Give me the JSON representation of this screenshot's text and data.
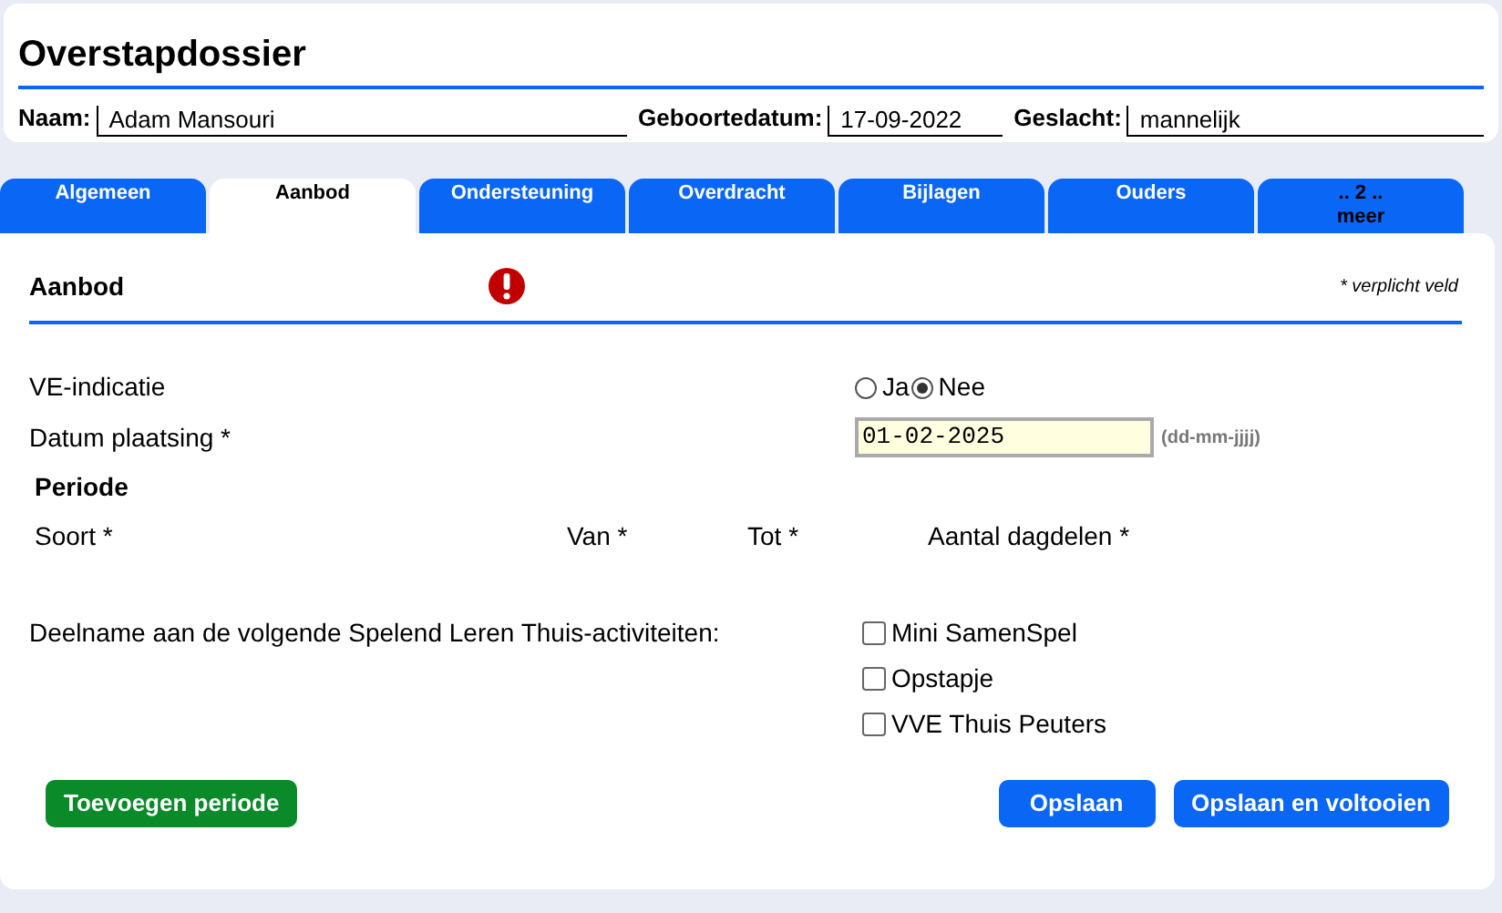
{
  "title": "Overstapdossier",
  "person": [
    {
      "label": "Naam:",
      "value": "Adam Mansouri"
    },
    {
      "label": "Geboortedatum:",
      "value": "17-09-2022"
    },
    {
      "label": "Geslacht:",
      "value": "mannelijk"
    }
  ],
  "tabs": [
    {
      "label": "Algemeen",
      "selected": false
    },
    {
      "label": "Aanbod",
      "selected": true
    },
    {
      "label": "Ondersteuning",
      "selected": false
    },
    {
      "label": "Overdracht",
      "selected": false
    },
    {
      "label": "Bijlagen",
      "selected": false
    },
    {
      "label": "Ouders",
      "selected": false
    },
    {
      "label": ".. 2 ..",
      "sublabel": "meer",
      "selected": false
    }
  ],
  "section": {
    "title": "Aanbod",
    "warning": true,
    "required_note": "* verplicht veld"
  },
  "ve_indicatie": {
    "label": "VE-indicatie",
    "options": [
      {
        "label": "Ja",
        "selected": false
      },
      {
        "label": "Nee",
        "selected": true
      }
    ]
  },
  "datum_plaatsing": {
    "label": "Datum plaatsing *",
    "value": "01-02-2025",
    "hint": "(dd-mm-jjjj)"
  },
  "periode": {
    "title": "Periode",
    "columns": [
      "Soort *",
      "Van *",
      "Tot *",
      "Aantal dagdelen *"
    ]
  },
  "activities": {
    "label": "Deelname aan de volgende Spelend Leren Thuis-activiteiten:",
    "options": [
      {
        "label": "Mini SamenSpel",
        "checked": false
      },
      {
        "label": "Opstapje",
        "checked": false
      },
      {
        "label": "VVE Thuis Peuters",
        "checked": false
      }
    ]
  },
  "buttons": [
    {
      "label": "Toevoegen periode",
      "kind": "add"
    },
    {
      "label": "Opslaan",
      "kind": "save"
    },
    {
      "label": "Opslaan en voltooien",
      "kind": "save"
    }
  ]
}
